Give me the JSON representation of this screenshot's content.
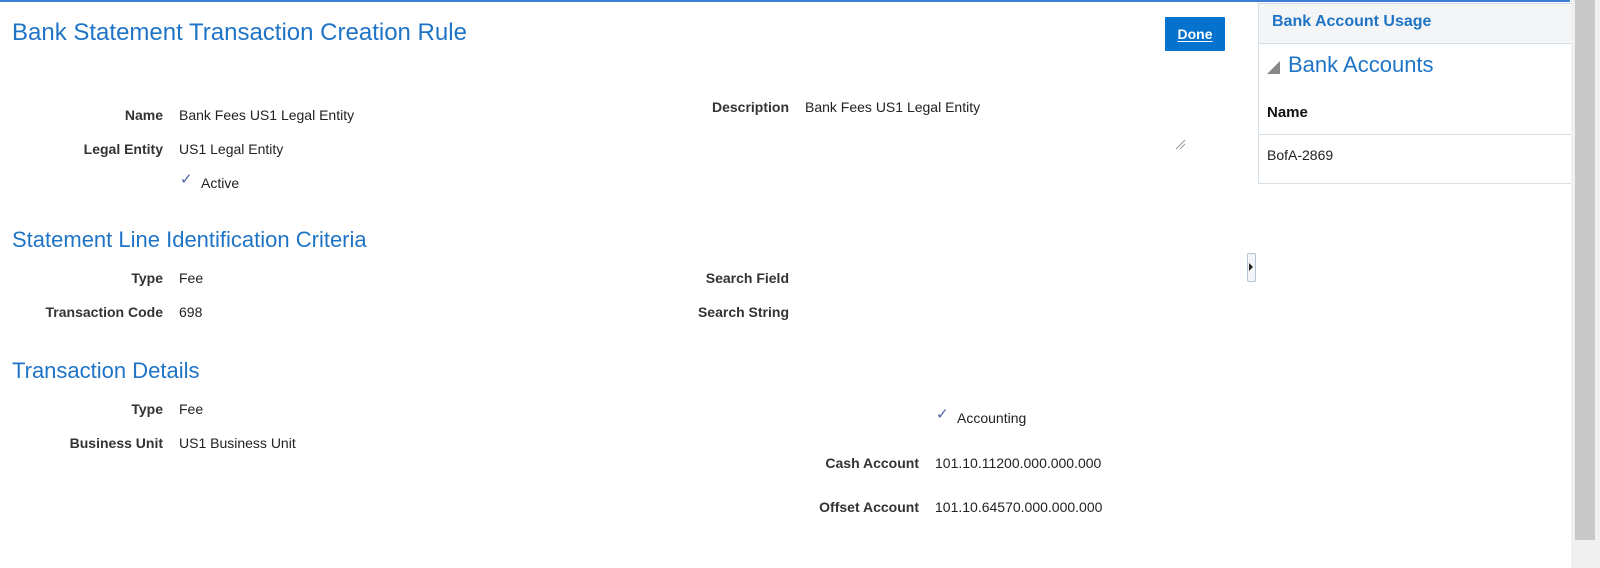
{
  "page": {
    "title": "Bank Statement Transaction Creation Rule",
    "done_label": "Done"
  },
  "rule": {
    "name_label": "Name",
    "name_value": "Bank Fees US1 Legal Entity",
    "legal_entity_label": "Legal Entity",
    "legal_entity_value": "US1 Legal Entity",
    "active_label": "Active",
    "active_checked": true,
    "description_label": "Description",
    "description_value": "Bank Fees US1 Legal Entity"
  },
  "criteria": {
    "title": "Statement Line Identification Criteria",
    "type_label": "Type",
    "type_value": "Fee",
    "transaction_code_label": "Transaction Code",
    "transaction_code_value": "698",
    "search_field_label": "Search Field",
    "search_field_value": "",
    "search_string_label": "Search String",
    "search_string_value": ""
  },
  "transaction_details": {
    "title": "Transaction Details",
    "type_label": "Type",
    "type_value": "Fee",
    "business_unit_label": "Business Unit",
    "business_unit_value": "US1 Business Unit",
    "accounting_label": "Accounting",
    "accounting_checked": true,
    "cash_account_label": "Cash Account",
    "cash_account_value": "101.10.11200.000.000.000",
    "offset_account_label": "Offset Account",
    "offset_account_value": "101.10.64570.000.000.000"
  },
  "side_panel": {
    "header": "Bank Account Usage",
    "subtitle": "Bank Accounts",
    "column_header": "Name",
    "rows": [
      "BofA-2869"
    ]
  },
  "colors": {
    "accent": "#1f74c6",
    "button": "#0572ce",
    "check": "#4a64a5"
  },
  "icons": {
    "check": "checkmark-icon",
    "collapse": "triangle-collapse-icon",
    "expand": "right-arrow-icon"
  }
}
